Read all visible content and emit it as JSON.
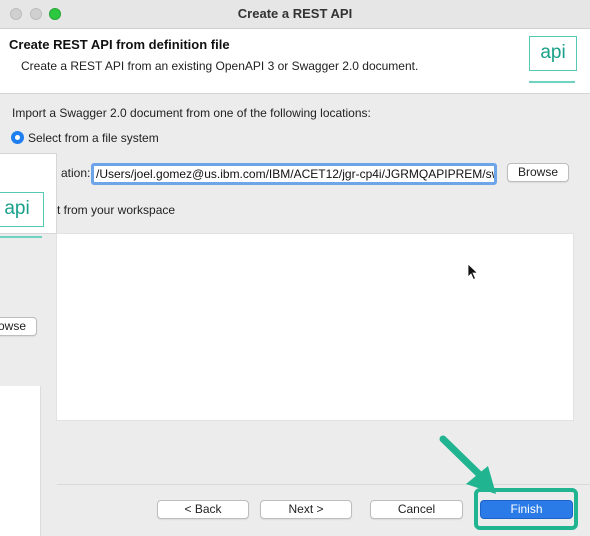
{
  "window": {
    "title": "Create a REST API"
  },
  "header": {
    "title": "Create REST API from definition file",
    "description": "Create a REST API from an existing OpenAPI 3 or Swagger 2.0 document.",
    "logo_text": "api"
  },
  "import": {
    "instruction": "Import a Swagger 2.0 document from one of the following locations:",
    "file_system_option": "Select from a file system",
    "location_label": "ation:",
    "location_value": "/Users/joel.gomez@us.ibm.com/IBM/ACET12/jgr-cp4i/JGRMQAPIPREM/swag",
    "browse_label": "Browse",
    "workspace_label": "t from your workspace"
  },
  "background_dialog": {
    "logo_text": "api",
    "browse_label": "owse"
  },
  "footer": {
    "back_label": "< Back",
    "next_label": "Next >",
    "cancel_label": "Cancel",
    "finish_label": "Finish"
  },
  "colors": {
    "accent": "#2a7be8",
    "highlight": "#21b491",
    "logo": "#1aa08a"
  },
  "icons": {
    "annotation_arrow": "arrow-down-right-icon",
    "cursor": "mouse-pointer-icon"
  }
}
